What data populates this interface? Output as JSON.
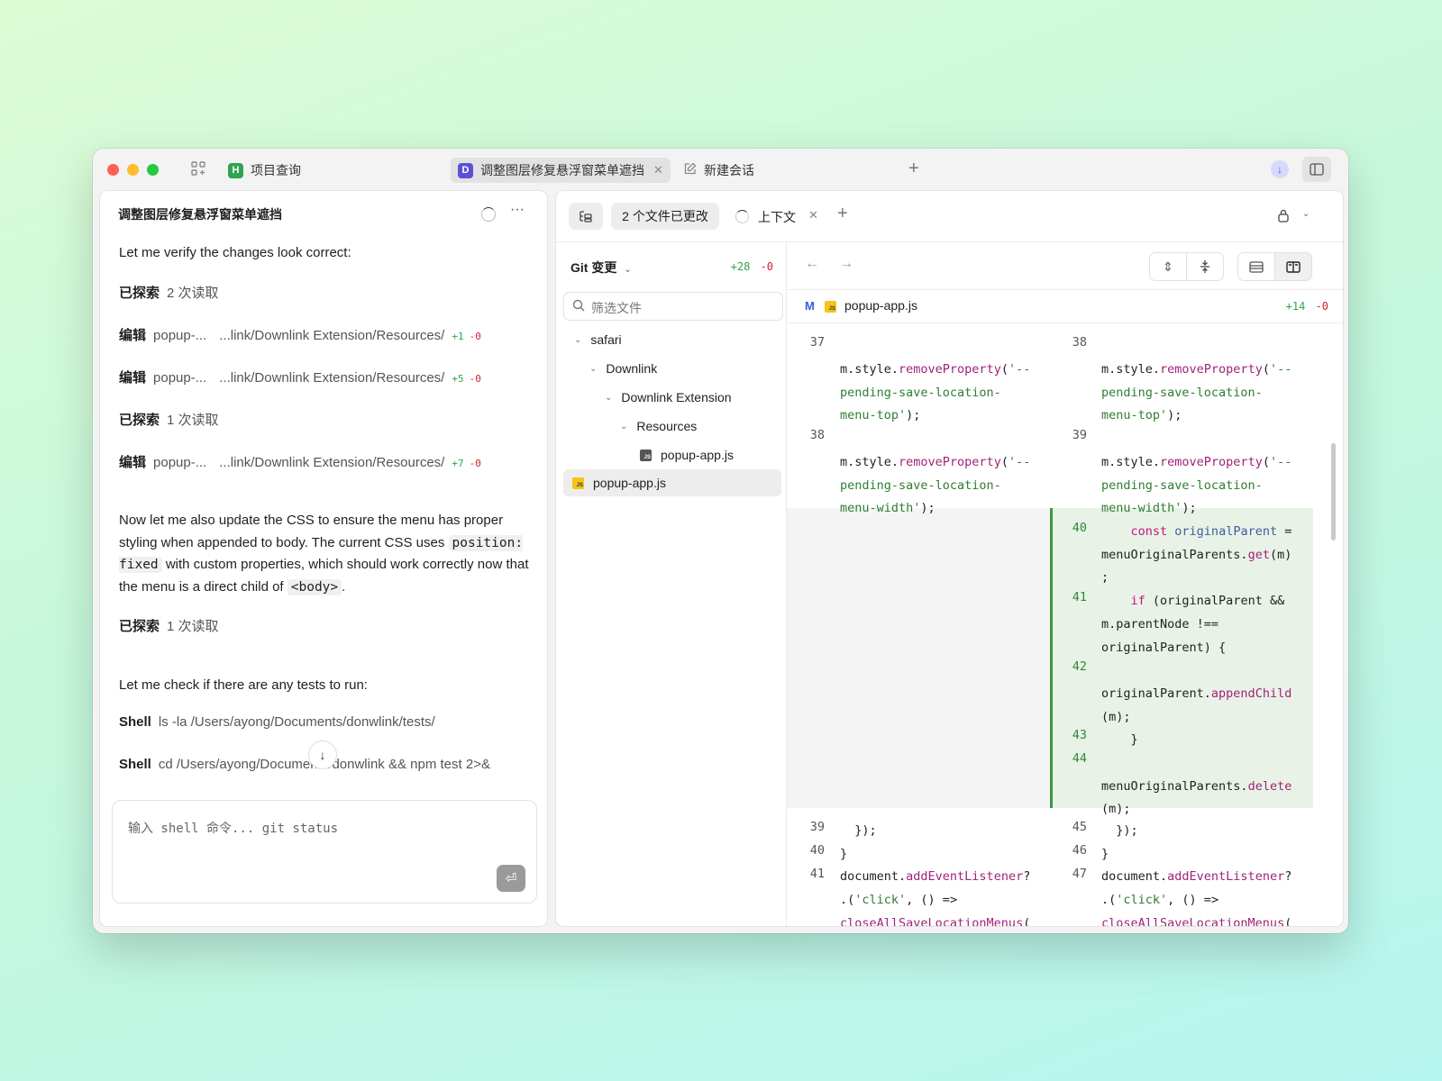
{
  "titlebar": {
    "tabs": [
      {
        "badge": "H",
        "badge_color": "#2ea44f",
        "label": "项目查询"
      },
      {
        "badge": "D",
        "badge_color": "#5b4fd6",
        "label": "调整图层修复悬浮窗菜单遮挡"
      },
      {
        "label": "新建会话"
      }
    ]
  },
  "left": {
    "title": "调整图层修复悬浮窗菜单遮挡",
    "intro": "Let me verify the changes look correct:",
    "items": [
      {
        "k": "已探索",
        "v": "2 次读取"
      },
      {
        "k": "编辑",
        "file": "popup-...",
        "path": "...link/Downlink Extension/Resources/",
        "plus": "+1",
        "minus": "-0"
      },
      {
        "k": "编辑",
        "file": "popup-...",
        "path": "...link/Downlink Extension/Resources/",
        "plus": "+5",
        "minus": "-0"
      },
      {
        "k": "已探索",
        "v": "1 次读取"
      },
      {
        "k": "编辑",
        "file": "popup-...",
        "path": "...link/Downlink Extension/Resources/",
        "plus": "+7",
        "minus": "-0"
      }
    ],
    "para1_a": "Now let me also update the CSS to ensure the menu has proper styling when appended to body. The current CSS uses",
    "para1_code1": "position: fixed",
    "para1_b": "with custom properties, which should work correctly now that the menu is a direct child of",
    "para1_code2": "<body>",
    "para1_c": ".",
    "explore3": {
      "k": "已探索",
      "v": "1 次读取"
    },
    "para2": "Let me check if there are any tests to run:",
    "shell1": {
      "k": "Shell",
      "v": "ls -la /Users/ayong/Documents/donwlink/tests/"
    },
    "shell2": {
      "k": "Shell",
      "v": "cd /Users/ayong/Documents/donwlink && npm test 2>&"
    },
    "input_placeholder": "输入 shell 命令... git status"
  },
  "right": {
    "changed_pill": "2 个文件已更改",
    "context_tab": "上下文",
    "git_header": "Git 变更",
    "git_plus": "+28",
    "git_minus": "-0",
    "filter_placeholder": "筛选文件",
    "tree": [
      {
        "label": "safari",
        "depth": 0,
        "type": "folder"
      },
      {
        "label": "Downlink",
        "depth": 1,
        "type": "folder"
      },
      {
        "label": "Downlink Extension",
        "depth": 2,
        "type": "folder"
      },
      {
        "label": "Resources",
        "depth": 3,
        "type": "folder"
      },
      {
        "label": "popup-app.js",
        "depth": 4,
        "type": "file"
      },
      {
        "label": "popup-app.js",
        "depth": 0,
        "type": "file-selected"
      }
    ],
    "file": {
      "status": "M",
      "name": "popup-app.js",
      "plus": "+14",
      "minus": "-0"
    }
  },
  "diff": {
    "left_lines": [
      "37",
      "38",
      "39",
      "40",
      "41"
    ],
    "right_lines": [
      "38",
      "39",
      "40",
      "41",
      "42",
      "43",
      "44",
      "45",
      "46",
      "47"
    ]
  }
}
